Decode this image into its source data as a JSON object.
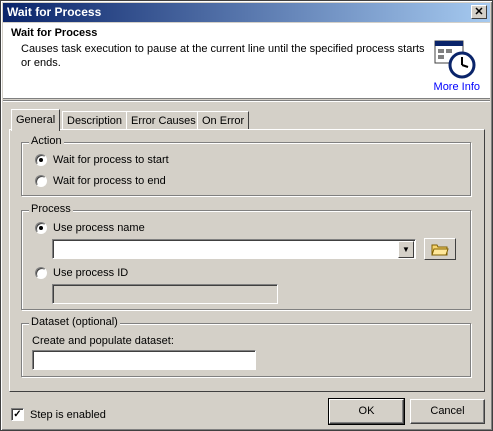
{
  "window": {
    "title": "Wait for Process",
    "close_glyph": "✕"
  },
  "header": {
    "title": "Wait for Process",
    "description": "Causes task execution to pause at the current line until the specified process starts or ends.",
    "icon": "clock-window-icon",
    "more_info": "More Info"
  },
  "tabs": [
    {
      "label": "General"
    },
    {
      "label": "Description"
    },
    {
      "label": "Error Causes"
    },
    {
      "label": "On Error"
    }
  ],
  "action": {
    "legend": "Action",
    "options": [
      {
        "label": "Wait for process to start",
        "selected": true
      },
      {
        "label": "Wait for process to end",
        "selected": false
      }
    ]
  },
  "process": {
    "legend": "Process",
    "use_name_label": "Use process name",
    "use_name_selected": true,
    "name_value": "",
    "use_id_label": "Use process ID",
    "use_id_selected": false,
    "id_value": "",
    "browse_icon": "folder-icon"
  },
  "dataset": {
    "legend": "Dataset (optional)",
    "label": "Create and populate dataset:",
    "value": ""
  },
  "footer": {
    "step_enabled_label": "Step is enabled",
    "step_enabled": true,
    "ok_label": "OK",
    "cancel_label": "Cancel"
  }
}
